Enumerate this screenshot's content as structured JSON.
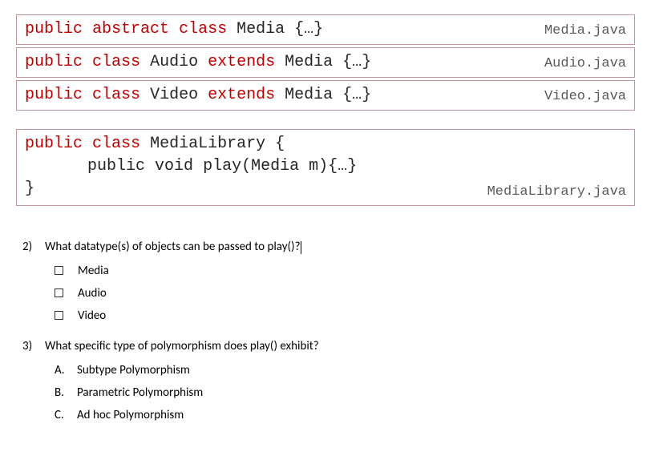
{
  "code_boxes": [
    {
      "filename": "Media.java",
      "tokens": {
        "public": "public",
        "abstract": "abstract",
        "class": "class",
        "classname": "Media",
        "open": "{",
        "ellipsis": "…",
        "close": "}"
      }
    },
    {
      "filename": "Audio.java",
      "tokens": {
        "public": "public",
        "class": "class",
        "classname": "Audio",
        "extends": "extends",
        "superclass": "Media",
        "open": "{",
        "ellipsis": "…",
        "close": "}"
      }
    },
    {
      "filename": "Video.java",
      "tokens": {
        "public": "public",
        "class": "class",
        "classname": "Video",
        "extends": "extends",
        "superclass": "Media",
        "open": "{",
        "ellipsis": "…",
        "close": "}"
      }
    }
  ],
  "library_box": {
    "filename": "MediaLibrary.java",
    "line1": {
      "public": "public",
      "class": "class",
      "classname": "MediaLibrary",
      "open": "{"
    },
    "line2": {
      "public": "public",
      "void": "void",
      "method": "play",
      "paren_open": "(",
      "paramtype": "Media",
      "paramname": "m",
      "paren_close": ")",
      "open": "{",
      "ellipsis": "…",
      "close": "}"
    },
    "line3": {
      "close": "}"
    }
  },
  "question2": {
    "num": "2)",
    "text": "What datatype(s) of objects can be passed to play()?",
    "options": [
      "Media",
      "Audio",
      "Video"
    ]
  },
  "question3": {
    "num": "3)",
    "text": "What specific type of polymorphism does play() exhibit?",
    "options": [
      {
        "letter": "A.",
        "text": "Subtype Polymorphism"
      },
      {
        "letter": "B.",
        "text": "Parametric Polymorphism"
      },
      {
        "letter": "C.",
        "text": "Ad hoc Polymorphism"
      }
    ]
  }
}
